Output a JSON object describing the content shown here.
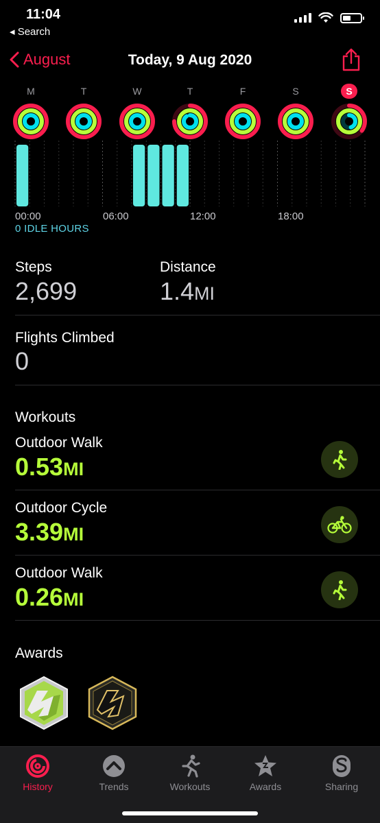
{
  "status_bar": {
    "time": "11:04",
    "back_app": "◂ Search",
    "battery_level": 0.45
  },
  "nav": {
    "back_label": "August",
    "title": "Today, 9 Aug 2020",
    "share_icon": "share-icon"
  },
  "week": {
    "days": [
      {
        "label": "M",
        "move": 1.0,
        "exercise": 1.0,
        "stand": 1.0
      },
      {
        "label": "T",
        "move": 1.0,
        "exercise": 1.0,
        "stand": 1.0
      },
      {
        "label": "W",
        "move": 1.0,
        "exercise": 1.0,
        "stand": 1.0
      },
      {
        "label": "T",
        "move": 0.75,
        "exercise": 1.0,
        "stand": 0.9
      },
      {
        "label": "F",
        "move": 1.0,
        "exercise": 1.0,
        "stand": 1.0
      },
      {
        "label": "S",
        "move": 1.0,
        "exercise": 1.0,
        "stand": 1.0
      },
      {
        "label": "S",
        "move": 0.35,
        "exercise": 1.0,
        "stand": 0.45,
        "selected": true
      }
    ],
    "colors": {
      "move": "#fa1e4e",
      "exercise": "#b6ff3a",
      "stand": "#00e0ee"
    }
  },
  "hourly": {
    "ticks": [
      "00:00",
      "06:00",
      "12:00",
      "18:00"
    ],
    "active_hours": [
      0,
      8,
      9,
      10,
      11
    ],
    "idle_text": "0 IDLE HOURS",
    "bar_color": "#5fe8e0"
  },
  "stats": {
    "steps_label": "Steps",
    "steps_value": "2,699",
    "distance_label": "Distance",
    "distance_value": "1.4",
    "distance_unit": "MI",
    "flights_label": "Flights Climbed",
    "flights_value": "0"
  },
  "workouts": {
    "title": "Workouts",
    "items": [
      {
        "name": "Outdoor Walk",
        "value": "0.53",
        "unit": "MI",
        "icon": "walking-icon"
      },
      {
        "name": "Outdoor Cycle",
        "value": "3.39",
        "unit": "MI",
        "icon": "cycling-icon"
      },
      {
        "name": "Outdoor Walk",
        "value": "0.26",
        "unit": "MI",
        "icon": "walking-icon"
      }
    ]
  },
  "awards": {
    "title": "Awards",
    "badges": [
      "green-hexagon-badge",
      "gold-hexagon-badge"
    ]
  },
  "tabbar": {
    "tabs": [
      {
        "label": "History",
        "icon": "history-rings-icon",
        "active": true
      },
      {
        "label": "Trends",
        "icon": "trends-icon"
      },
      {
        "label": "Workouts",
        "icon": "running-figure-icon"
      },
      {
        "label": "Awards",
        "icon": "star-award-icon"
      },
      {
        "label": "Sharing",
        "icon": "sharing-icon"
      }
    ]
  }
}
